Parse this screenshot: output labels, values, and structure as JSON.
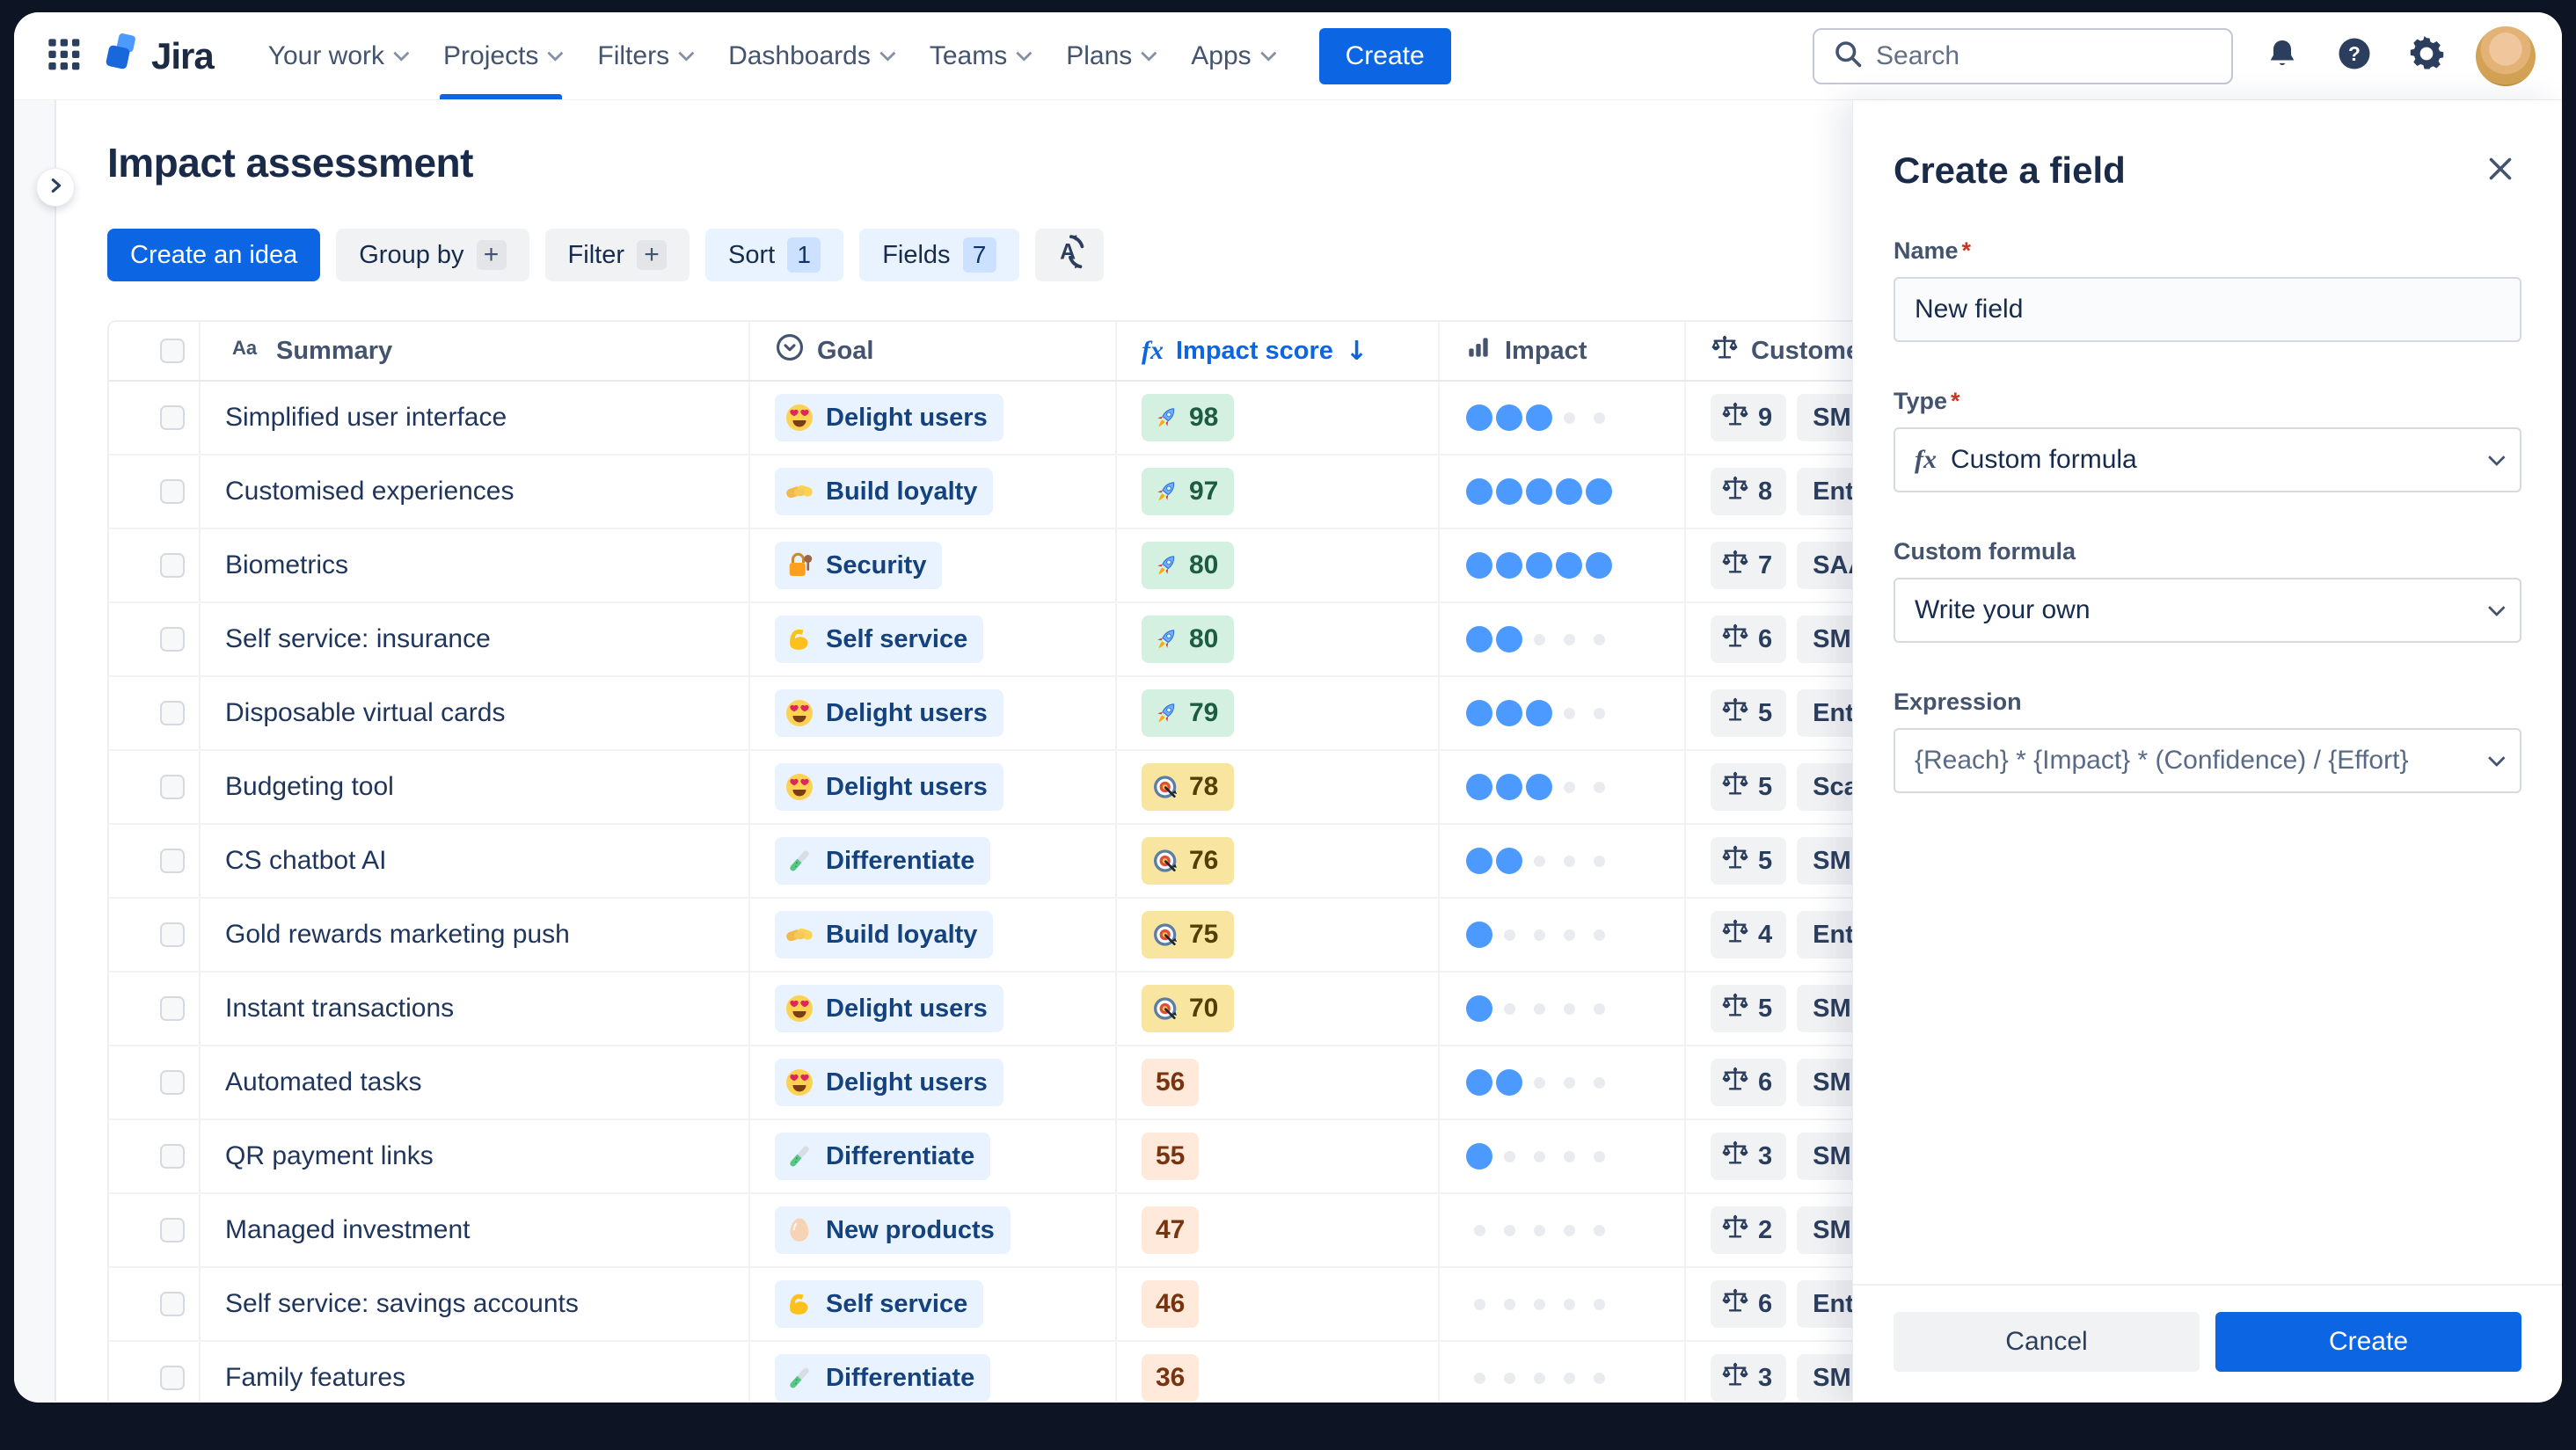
{
  "nav": {
    "logo_text": "Jira",
    "items": [
      {
        "label": "Your work",
        "active": false
      },
      {
        "label": "Projects",
        "active": true
      },
      {
        "label": "Filters",
        "active": false
      },
      {
        "label": "Dashboards",
        "active": false
      },
      {
        "label": "Teams",
        "active": false
      },
      {
        "label": "Plans",
        "active": false
      },
      {
        "label": "Apps",
        "active": false
      }
    ],
    "create_button": "Create",
    "search_placeholder": "Search",
    "icons": [
      "app-switcher-icon",
      "jira-logo",
      "search-icon",
      "bell-icon",
      "help-icon",
      "gear-icon",
      "avatar"
    ]
  },
  "page": {
    "title": "Impact assessment",
    "toolbar": {
      "create_idea": "Create an idea",
      "group_by": "Group by",
      "filter": "Filter",
      "sort": "Sort",
      "sort_count": "1",
      "fields": "Fields",
      "fields_count": "7",
      "extra_icon": "auto-format-icon"
    },
    "table": {
      "columns": [
        {
          "label": "Summary",
          "icon": "text",
          "sorted": false
        },
        {
          "label": "Goal",
          "icon": "select",
          "sorted": false
        },
        {
          "label": "Impact score",
          "icon": "formula",
          "sorted": true,
          "sort_dir": "desc"
        },
        {
          "label": "Impact",
          "icon": "rating",
          "sorted": false
        },
        {
          "label": "Customer",
          "icon": "weight",
          "sorted": false
        }
      ],
      "rows": [
        {
          "summary": "Simplified user interface",
          "goal": {
            "label": "Delight users",
            "icon": "heart-eyes"
          },
          "score": {
            "value": "98",
            "style": "green",
            "icon": "rocket"
          },
          "impact": 3,
          "customer": {
            "weight": "9",
            "label": "SMB"
          }
        },
        {
          "summary": "Customised experiences",
          "goal": {
            "label": "Build loyalty",
            "icon": "handshake"
          },
          "score": {
            "value": "97",
            "style": "green",
            "icon": "rocket"
          },
          "impact": 5,
          "customer": {
            "weight": "8",
            "label": "Enter"
          }
        },
        {
          "summary": "Biometrics",
          "goal": {
            "label": "Security",
            "icon": "lock"
          },
          "score": {
            "value": "80",
            "style": "green",
            "icon": "rocket"
          },
          "impact": 5,
          "customer": {
            "weight": "7",
            "label": "SAAS"
          }
        },
        {
          "summary": "Self service: insurance",
          "goal": {
            "label": "Self service",
            "icon": "muscle"
          },
          "score": {
            "value": "80",
            "style": "green",
            "icon": "rocket"
          },
          "impact": 2,
          "customer": {
            "weight": "6",
            "label": "SMB"
          }
        },
        {
          "summary": "Disposable virtual cards",
          "goal": {
            "label": "Delight users",
            "icon": "heart-eyes"
          },
          "score": {
            "value": "79",
            "style": "green",
            "icon": "rocket"
          },
          "impact": 3,
          "customer": {
            "weight": "5",
            "label": "Enterp"
          }
        },
        {
          "summary": "Budgeting tool",
          "goal": {
            "label": "Delight users",
            "icon": "heart-eyes"
          },
          "score": {
            "value": "78",
            "style": "yellow",
            "icon": "target"
          },
          "impact": 3,
          "customer": {
            "weight": "5",
            "label": "Scale"
          }
        },
        {
          "summary": "CS chatbot AI",
          "goal": {
            "label": "Differentiate",
            "icon": "testtube"
          },
          "score": {
            "value": "76",
            "style": "yellow",
            "icon": "target"
          },
          "impact": 2,
          "customer": {
            "weight": "5",
            "label": "SMB"
          }
        },
        {
          "summary": "Gold rewards marketing push",
          "goal": {
            "label": "Build loyalty",
            "icon": "handshake"
          },
          "score": {
            "value": "75",
            "style": "yellow",
            "icon": "target"
          },
          "impact": 1,
          "customer": {
            "weight": "4",
            "label": "Enter"
          }
        },
        {
          "summary": "Instant transactions",
          "goal": {
            "label": "Delight users",
            "icon": "heart-eyes"
          },
          "score": {
            "value": "70",
            "style": "yellow",
            "icon": "target"
          },
          "impact": 1,
          "customer": {
            "weight": "5",
            "label": "SMB"
          }
        },
        {
          "summary": "Automated tasks",
          "goal": {
            "label": "Delight users",
            "icon": "heart-eyes"
          },
          "score": {
            "value": "56",
            "style": "peach",
            "icon": null
          },
          "impact": 2,
          "customer": {
            "weight": "6",
            "label": "SMB"
          }
        },
        {
          "summary": "QR payment links",
          "goal": {
            "label": "Differentiate",
            "icon": "testtube"
          },
          "score": {
            "value": "55",
            "style": "peach",
            "icon": null
          },
          "impact": 1,
          "customer": {
            "weight": "3",
            "label": "SMB"
          }
        },
        {
          "summary": "Managed investment",
          "goal": {
            "label": "New products",
            "icon": "egg"
          },
          "score": {
            "value": "47",
            "style": "peach",
            "icon": null
          },
          "impact": 0,
          "customer": {
            "weight": "2",
            "label": "SMB"
          }
        },
        {
          "summary": "Self service: savings accounts",
          "goal": {
            "label": "Self service",
            "icon": "muscle"
          },
          "score": {
            "value": "46",
            "style": "peach",
            "icon": null
          },
          "impact": 0,
          "customer": {
            "weight": "6",
            "label": "Enter"
          }
        },
        {
          "summary": "Family features",
          "goal": {
            "label": "Differentiate",
            "icon": "testtube"
          },
          "score": {
            "value": "36",
            "style": "peach",
            "icon": null
          },
          "impact": 0,
          "customer": {
            "weight": "3",
            "label": "SMB"
          }
        }
      ],
      "impact_dots_total": 5
    }
  },
  "panel": {
    "title": "Create a field",
    "name_label": "Name",
    "name_value": "New field",
    "type_label": "Type",
    "type_value": "Custom formula",
    "custom_formula_label": "Custom formula",
    "custom_formula_value": "Write your own",
    "expression_label": "Expression",
    "expression_value": "{Reach} * {Impact} * (Confidence) / {Effort}",
    "cancel_button": "Cancel",
    "create_button": "Create"
  },
  "colors": {
    "accent_blue": "#0c66e4",
    "nav_text": "#44546f",
    "score_green_bg": "#d4f0e0",
    "score_yellow_bg": "#f8e6a0",
    "score_peach_bg": "#ffe9da",
    "goal_pill_bg": "#e9f2ff",
    "impact_dot_on": "#4c9aff",
    "frame_bg": "#0d1424"
  }
}
